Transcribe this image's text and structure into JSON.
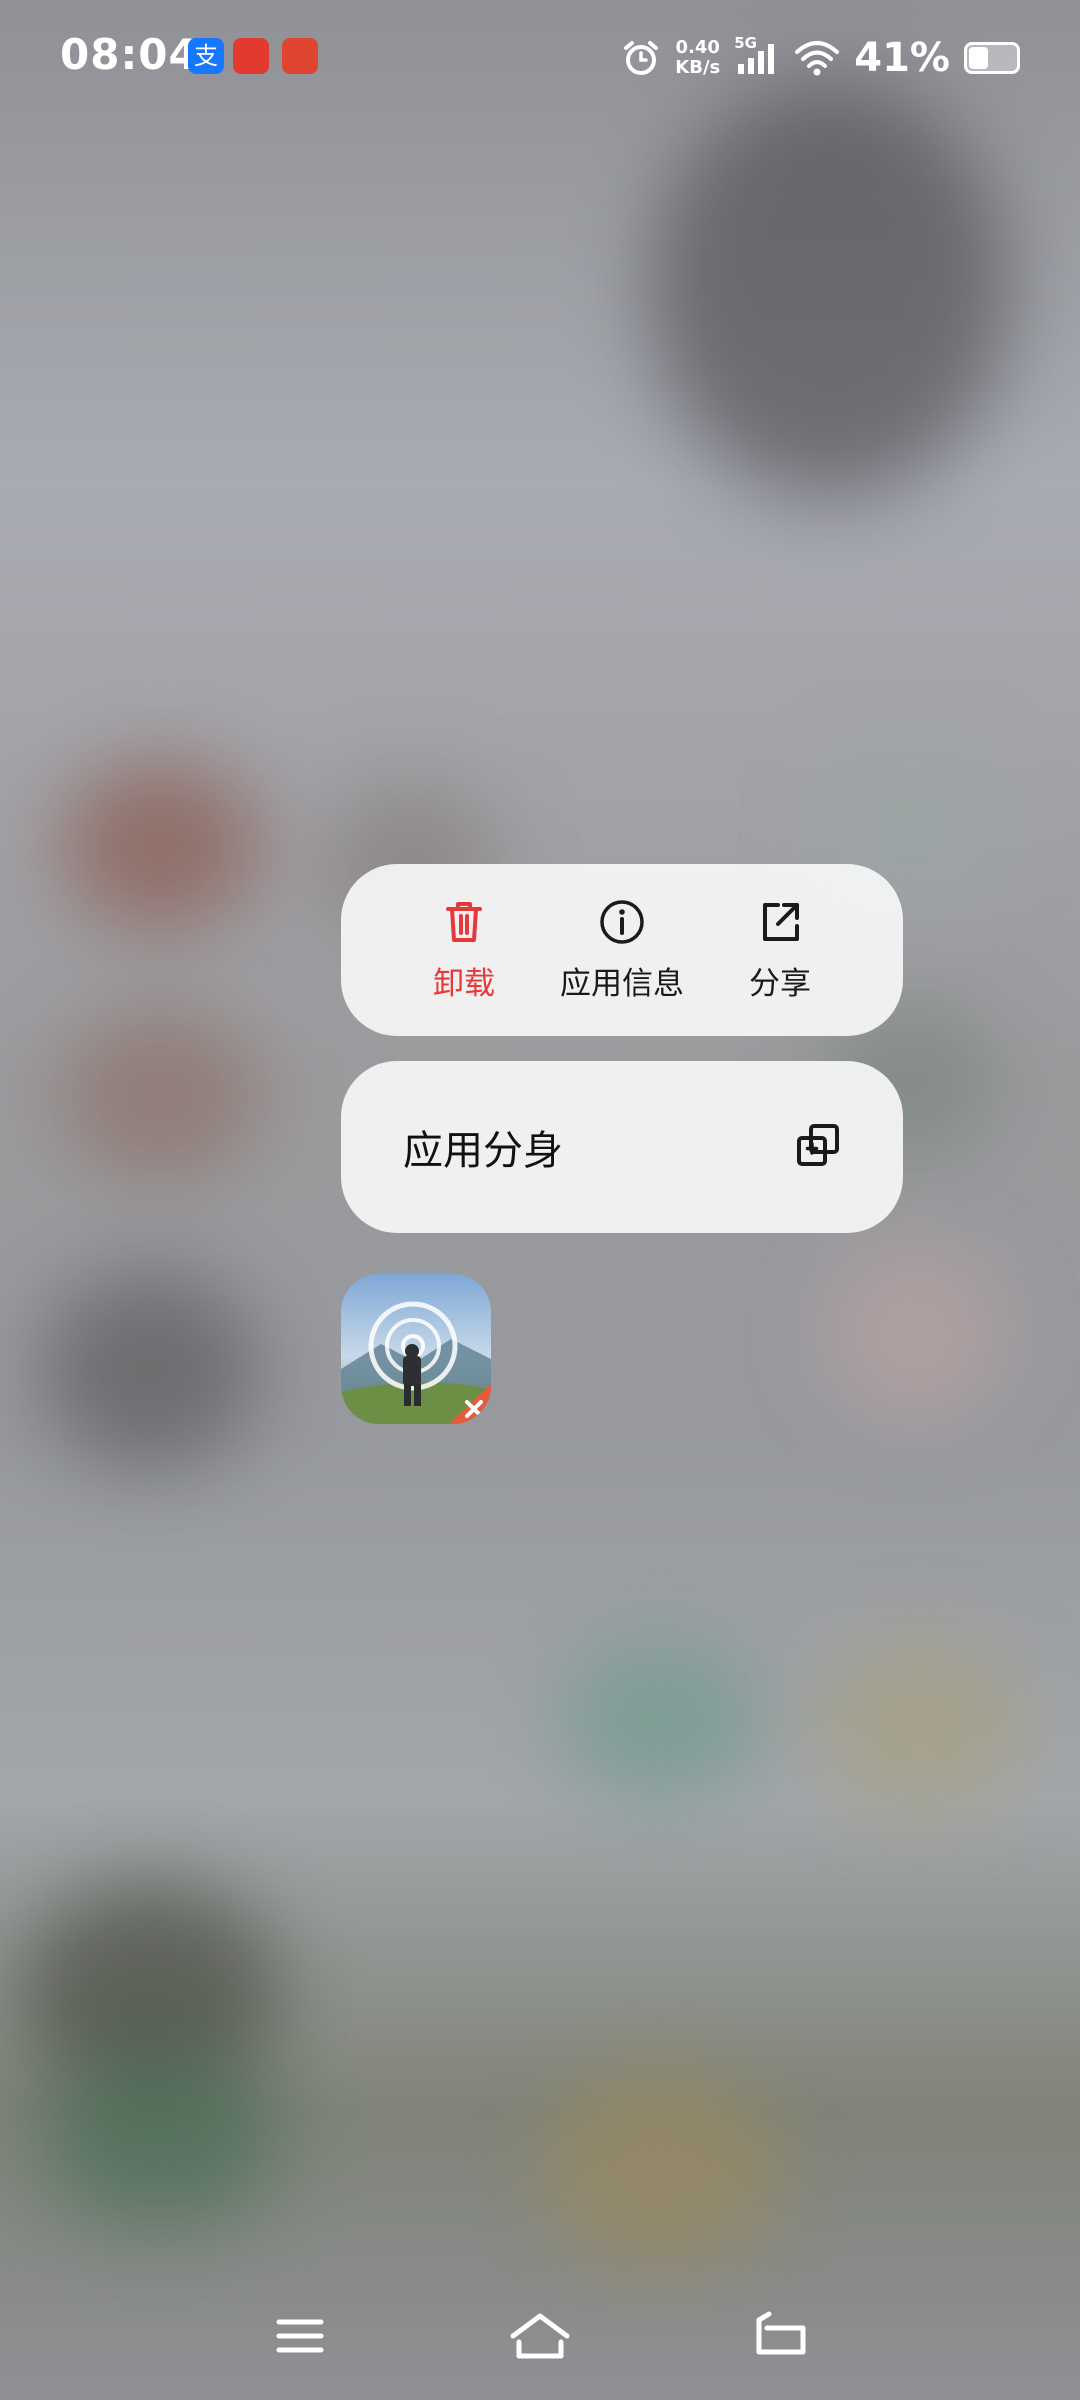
{
  "status_bar": {
    "time": "08:04",
    "net_speed_value": "0.40",
    "net_speed_unit": "KB/s",
    "network_type": "5G",
    "battery_percent": "41%",
    "battery_level": 0.41,
    "notification_icons": [
      "alipay-icon",
      "red-app-icon",
      "gift-app-icon"
    ],
    "status_icons": [
      "alarm-icon",
      "signal-icon",
      "wifi-icon",
      "battery-icon"
    ]
  },
  "context_menu": {
    "actions": [
      {
        "label": "卸载",
        "icon": "trash-icon",
        "color": "#e63a3a"
      },
      {
        "label": "应用信息",
        "icon": "info-icon",
        "color": "#1a1a1a"
      },
      {
        "label": "分享",
        "icon": "share-icon",
        "color": "#1a1a1a"
      }
    ],
    "clone": {
      "label": "应用分身",
      "icon": "clone-icon"
    }
  },
  "app": {
    "icon": "game-app-icon"
  },
  "nav_bar": {
    "items": [
      "menu-icon",
      "home-icon",
      "back-icon"
    ]
  }
}
